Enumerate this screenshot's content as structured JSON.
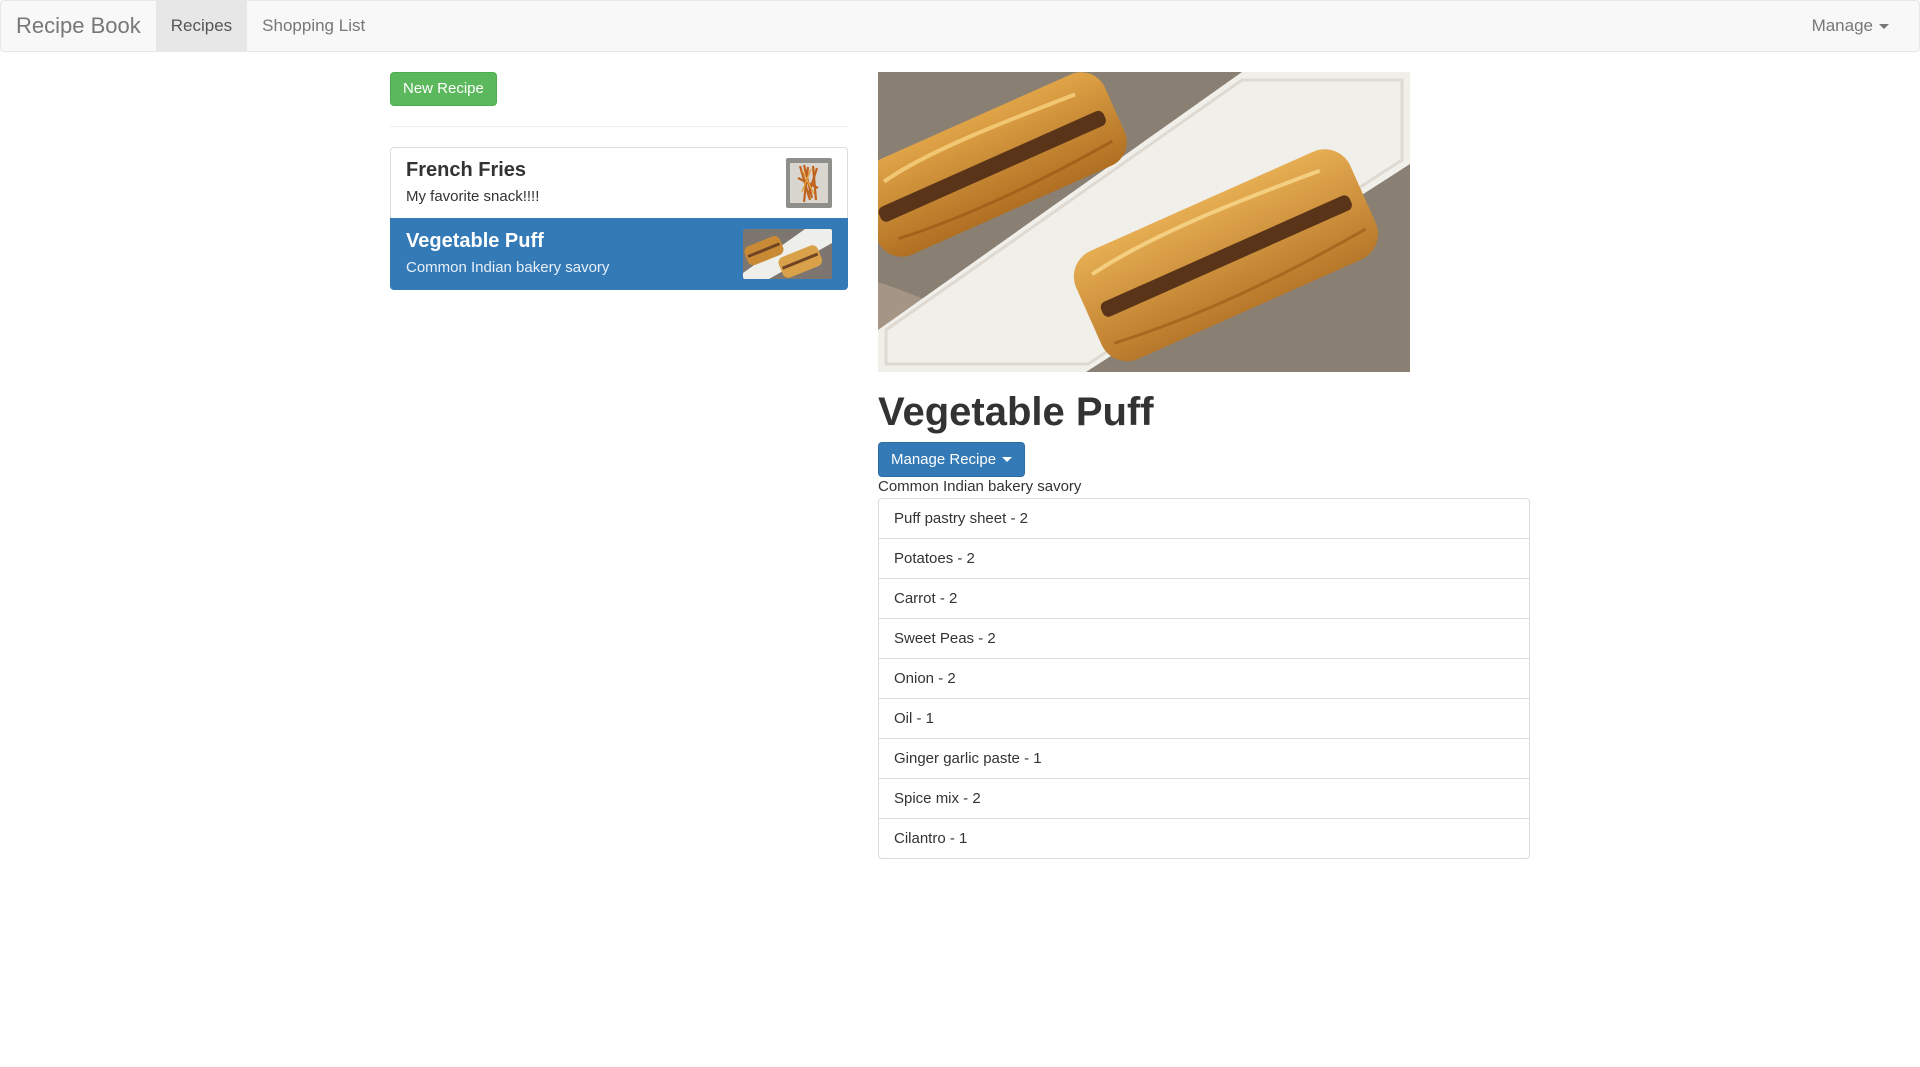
{
  "navbar": {
    "brand": "Recipe Book",
    "links": [
      {
        "label": "Recipes",
        "active": true
      },
      {
        "label": "Shopping List",
        "active": false
      }
    ],
    "manage_label": "Manage"
  },
  "sidebar": {
    "new_recipe_label": "New Recipe",
    "recipes": [
      {
        "name": "French Fries",
        "description": "My favorite snack!!!!",
        "active": false
      },
      {
        "name": "Vegetable Puff",
        "description": "Common Indian bakery savory",
        "active": true
      }
    ]
  },
  "detail": {
    "title": "Vegetable Puff",
    "manage_button_label": "Manage Recipe",
    "description": "Common Indian bakery savory",
    "ingredients": [
      "Puff pastry sheet - 2",
      "Potatoes - 2",
      "Carrot - 2",
      "Sweet Peas - 2",
      "Onion - 2",
      "Oil - 1",
      "Ginger garlic paste - 1",
      "Spice mix - 2",
      "Cilantro - 1"
    ]
  },
  "colors": {
    "primary": "#337ab7",
    "success": "#5cb85c",
    "navbar_bg": "#f8f8f8"
  }
}
